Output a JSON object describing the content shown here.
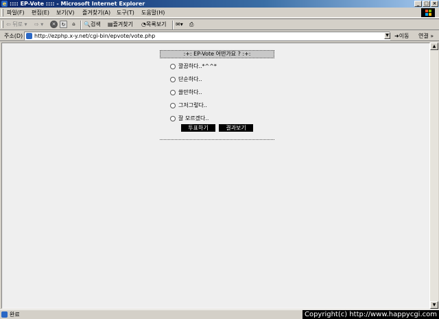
{
  "window": {
    "title": ":::: EP-Vote :::: - Microsoft Internet Explorer",
    "controls": [
      "_",
      "□",
      "×"
    ]
  },
  "menu": [
    "파일(F)",
    "편집(E)",
    "보기(V)",
    "즐겨찾기(A)",
    "도구(T)",
    "도움말(H)"
  ],
  "toolbar": {
    "back": "뒤로",
    "search": "검색",
    "favorites": "즐겨찾기",
    "history": "목록보기"
  },
  "address": {
    "label": "주소(D)",
    "url": "http://ezphp.x-y.net/cgi-bin/epvote/vote.php",
    "go": "이동",
    "links": "연결 »"
  },
  "vote": {
    "title": ":+: EP-Vote 어떤가요 ? :+:",
    "options": [
      "깔끔하다..*^^*",
      "단순하다..",
      "쓸만하다..",
      "그저그렇다..",
      "잘 모르겠다.."
    ],
    "vote_button": "투표하기",
    "result_button": "결과보기"
  },
  "status": {
    "text": "완료",
    "copyright": "Copyright(c) http://www.happycgi.com"
  }
}
